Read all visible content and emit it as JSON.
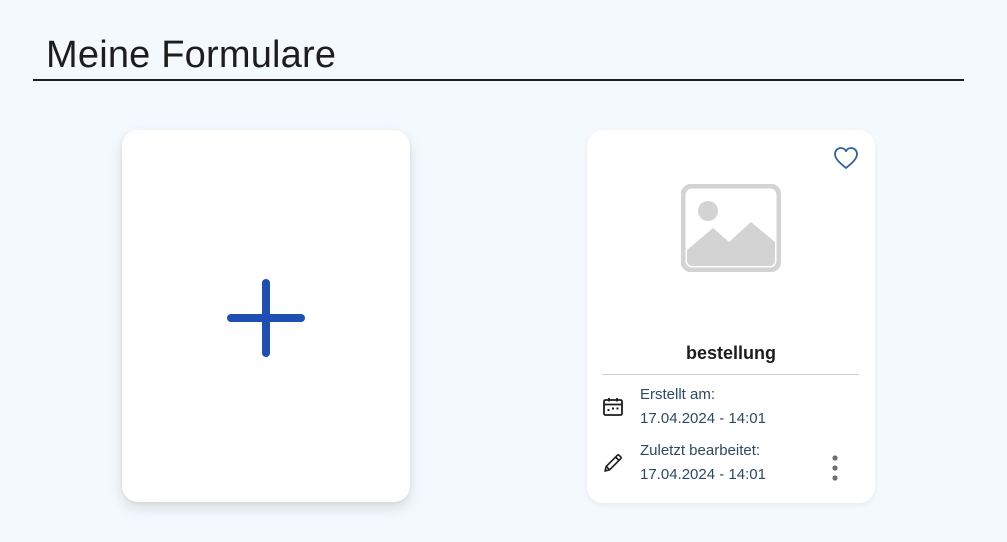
{
  "page": {
    "title": "Meine Formulare"
  },
  "new_form_card": {
    "icon": "plus-icon"
  },
  "forms": [
    {
      "name": "bestellung",
      "favorite_icon": "heart-outline-icon",
      "thumbnail_icon": "image-placeholder-icon",
      "created_label": "Erstellt am:",
      "created_value": "17.04.2024 - 14:01",
      "edited_label": "Zuletzt bearbeitet:",
      "edited_value": "17.04.2024 - 14:01",
      "menu_icon": "more-vertical-icon"
    }
  ],
  "colors": {
    "background": "#f4f9fe",
    "accent_blue": "#1f4fb3",
    "heart_blue": "#2f5f9f",
    "placeholder_gray": "#d3d3d3",
    "meta_text": "#2b4a63"
  }
}
